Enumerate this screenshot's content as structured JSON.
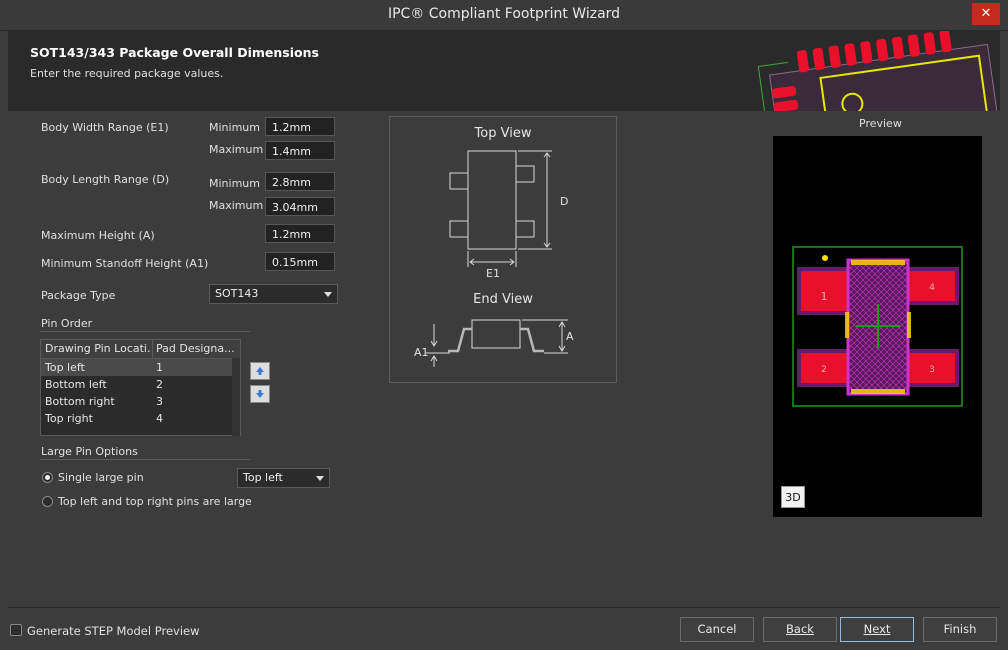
{
  "window": {
    "title": "IPC® Compliant Footprint Wizard",
    "close_glyph": "✕"
  },
  "header": {
    "title": "SOT143/343 Package Overall Dimensions",
    "subtitle": "Enter the required package values."
  },
  "dimensions": {
    "body_width": {
      "label": "Body Width Range (E1)",
      "min_label": "Minimum",
      "max_label": "Maximum",
      "min": "1.2mm",
      "max": "1.4mm"
    },
    "body_length": {
      "label": "Body Length Range (D)",
      "min_label": "Minimum",
      "max_label": "Maximum",
      "min": "2.8mm",
      "max": "3.04mm"
    },
    "max_height": {
      "label": "Maximum Height (A)",
      "value": "1.2mm"
    },
    "min_standoff": {
      "label": "Minimum Standoff Height (A1)",
      "value": "0.15mm"
    },
    "package_type": {
      "label": "Package Type",
      "value": "SOT143"
    }
  },
  "pin_order": {
    "section_label": "Pin Order",
    "columns": [
      "Drawing Pin Locati...",
      "Pad Designa..."
    ],
    "rows": [
      {
        "location": "Top left",
        "pad": "1",
        "selected": true
      },
      {
        "location": "Bottom left",
        "pad": "2",
        "selected": false
      },
      {
        "location": "Bottom right",
        "pad": "3",
        "selected": false
      },
      {
        "location": "Top right",
        "pad": "4",
        "selected": false
      }
    ],
    "move_up_icon": "arrow-up-icon",
    "move_down_icon": "arrow-down-icon"
  },
  "large_pin": {
    "section_label": "Large Pin Options",
    "single_label": "Single large pin",
    "single_selected": true,
    "single_value": "Top left",
    "both_label": "Top left and top right pins are large",
    "both_selected": false
  },
  "diagram": {
    "top_view": "Top View",
    "end_view": "End View",
    "d_label": "D",
    "e1_label": "E1",
    "a_label": "A",
    "a1_label": "A1"
  },
  "preview": {
    "label": "Preview",
    "pads": [
      "1",
      "2",
      "3",
      "4"
    ],
    "btn_3d": "3D",
    "colors": {
      "pad": "#e8102a",
      "outline": "#1a8a1a",
      "courtyard": "#cc33cc",
      "dot": "#f2e400"
    }
  },
  "footer": {
    "step_label": "Generate STEP Model Preview",
    "step_checked": false,
    "cancel": "Cancel",
    "back": "Back",
    "next": "Next",
    "finish": "Finish"
  }
}
